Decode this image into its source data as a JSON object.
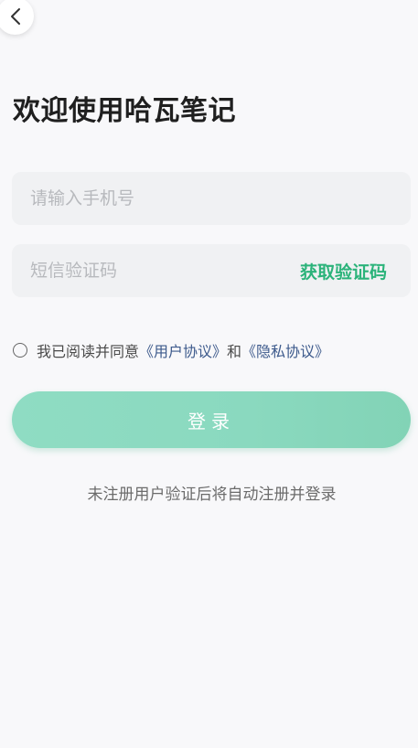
{
  "header": {
    "back_icon": "chevron-left-icon",
    "title": "欢迎使用哈瓦笔记"
  },
  "form": {
    "phone_placeholder": "请输入手机号",
    "code_placeholder": "短信验证码",
    "get_code_label": "获取验证码",
    "agreement": {
      "prefix": "我已阅读并同意",
      "user_agreement": "《用户协议》",
      "and": "和",
      "privacy_agreement": "《隐私协议》",
      "checked": false
    },
    "login_label": "登录",
    "hint": "未注册用户验证后将自动注册并登录"
  },
  "colors": {
    "accent": "#2bb37a",
    "button": "#8ad9bf",
    "link": "#3d5a8c",
    "background": "#f8f8fa",
    "field": "#f0f1f3"
  }
}
